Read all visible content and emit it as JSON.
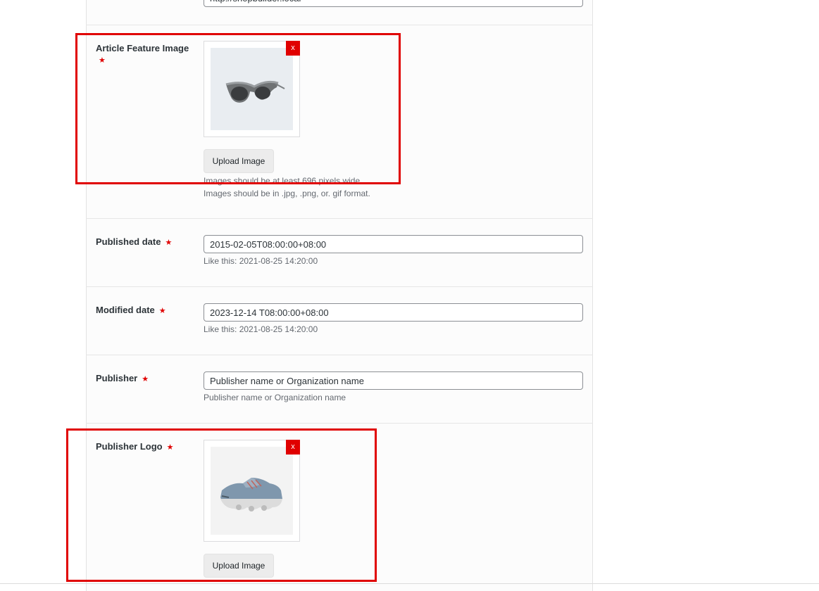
{
  "site_url": {
    "value": "http://shopbuilder.local"
  },
  "feature_image": {
    "label": "Article Feature Image",
    "required_mark": "★",
    "remove_label": "x",
    "image_icon": "sunglasses-photo",
    "upload_label": "Upload Image",
    "hint_width": "Images should be at least 696 pixels wide.",
    "hint_format": "Images should be in .jpg, .png, or. gif format."
  },
  "published_date": {
    "label": "Published date",
    "required_mark": "★",
    "value": "2015-02-05T08:00:00+08:00",
    "hint": "Like this: 2021-08-25 14:20:00"
  },
  "modified_date": {
    "label": "Modified date",
    "required_mark": "★",
    "value": "2023-12-14 T08:00:00+08:00",
    "hint": "Like this: 2021-08-25 14:20:00"
  },
  "publisher": {
    "label": "Publisher",
    "required_mark": "★",
    "value": "Publisher name or Organization name",
    "hint": "Publisher name or Organization name"
  },
  "publisher_logo": {
    "label": "Publisher Logo",
    "required_mark": "★",
    "remove_label": "x",
    "image_icon": "sneaker-photo",
    "upload_label": "Upload Image"
  },
  "colors": {
    "required": "#e00000",
    "highlight": "#e00000",
    "remove_button": "#e00000"
  }
}
